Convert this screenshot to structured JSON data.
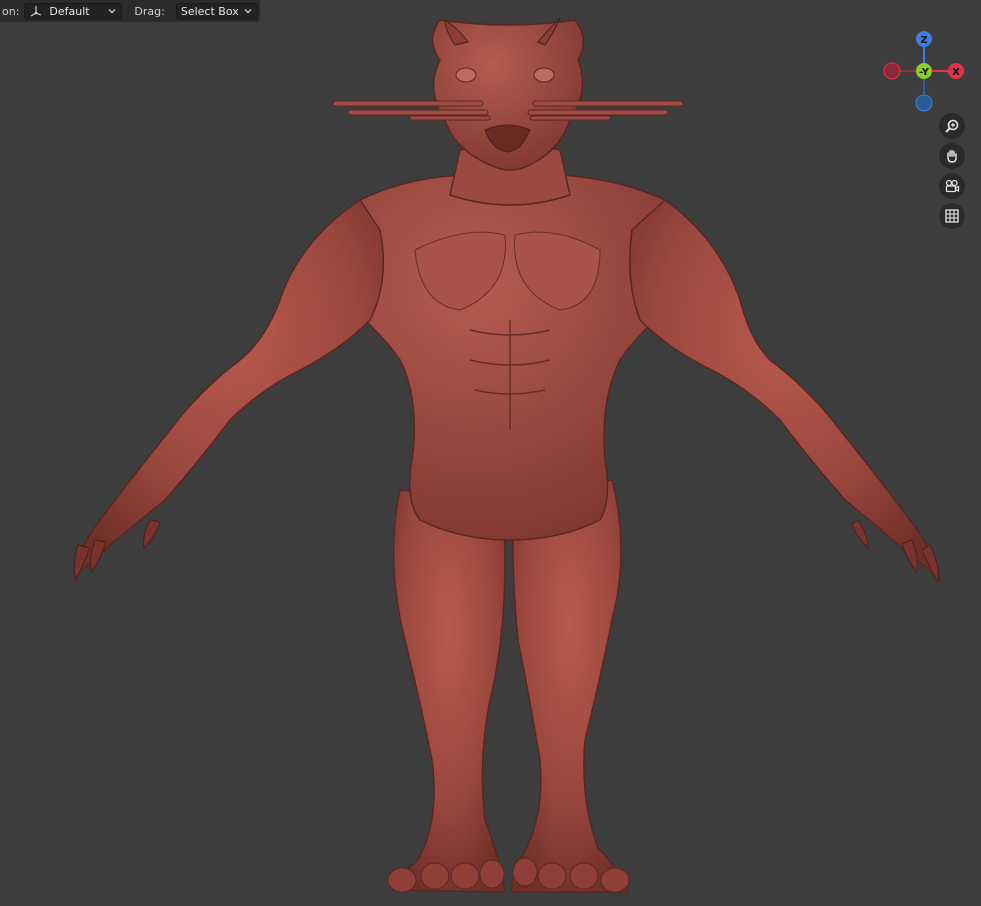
{
  "header": {
    "orientation_label": "on:",
    "orientation_value": "Default",
    "drag_label": "Drag:",
    "drag_value": "Select Box"
  },
  "gizmo": {
    "z_label": "Z",
    "y_label": "-Y",
    "x_label": "X"
  },
  "colors": {
    "background": "#3d3d3d",
    "model": "#9e4a40",
    "axis_x": "#e0344c",
    "axis_y": "#8ad028",
    "axis_z": "#3a7ee0"
  },
  "icons": {
    "orientation": "transform-orientation-icon",
    "zoom": "zoom-icon",
    "pan": "pan-hand-icon",
    "camera": "camera-view-icon",
    "grid": "ortho-grid-icon"
  }
}
